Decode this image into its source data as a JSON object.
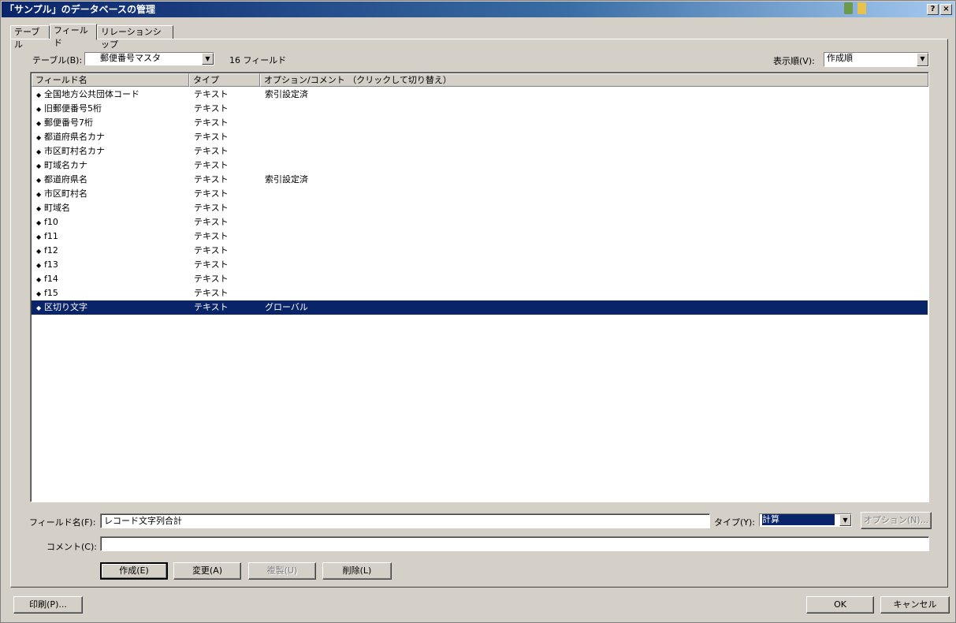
{
  "window": {
    "title": "「サンプル」のデータベースの管理",
    "help_btn": "?",
    "close_btn": "×"
  },
  "tabs": [
    {
      "label": "テーブル"
    },
    {
      "label": "フィールド"
    },
    {
      "label": "リレーションシップ"
    }
  ],
  "table_select": {
    "label": "テーブル(B):",
    "value": "郵便番号マスタ",
    "field_count": "16 フィールド"
  },
  "sort": {
    "label": "表示順(V):",
    "value": "作成順"
  },
  "columns": [
    "フィールド名",
    "タイプ",
    "オプション/コメント （クリックして切り替え）"
  ],
  "fields": [
    {
      "name": "全国地方公共団体コード",
      "type": "テキスト",
      "option": "索引設定済"
    },
    {
      "name": "旧郵便番号5桁",
      "type": "テキスト",
      "option": ""
    },
    {
      "name": "郵便番号7桁",
      "type": "テキスト",
      "option": ""
    },
    {
      "name": "都道府県名カナ",
      "type": "テキスト",
      "option": ""
    },
    {
      "name": "市区町村名カナ",
      "type": "テキスト",
      "option": ""
    },
    {
      "name": "町域名カナ",
      "type": "テキスト",
      "option": ""
    },
    {
      "name": "都道府県名",
      "type": "テキスト",
      "option": "索引設定済"
    },
    {
      "name": "市区町村名",
      "type": "テキスト",
      "option": ""
    },
    {
      "name": "町域名",
      "type": "テキスト",
      "option": ""
    },
    {
      "name": "f10",
      "type": "テキスト",
      "option": ""
    },
    {
      "name": "f11",
      "type": "テキスト",
      "option": ""
    },
    {
      "name": "f12",
      "type": "テキスト",
      "option": ""
    },
    {
      "name": "f13",
      "type": "テキスト",
      "option": ""
    },
    {
      "name": "f14",
      "type": "テキスト",
      "option": ""
    },
    {
      "name": "f15",
      "type": "テキスト",
      "option": ""
    },
    {
      "name": "区切り文字",
      "type": "テキスト",
      "option": "グローバル",
      "selected": true
    }
  ],
  "editor": {
    "field_name_label": "フィールド名(F):",
    "field_name_value": "レコード文字列合計",
    "type_label": "タイプ(Y):",
    "type_value": "計算",
    "options_btn": "オプション(N)...",
    "comment_label": "コメント(C):",
    "comment_value": ""
  },
  "actions": {
    "create": "作成(E)",
    "change": "変更(A)",
    "duplicate": "複製(U)",
    "delete": "削除(L)"
  },
  "footer": {
    "print": "印刷(P)...",
    "ok": "OK",
    "cancel": "キャンセル"
  },
  "colors": {
    "selection": "#0a246a",
    "face": "#d4d0c8"
  }
}
